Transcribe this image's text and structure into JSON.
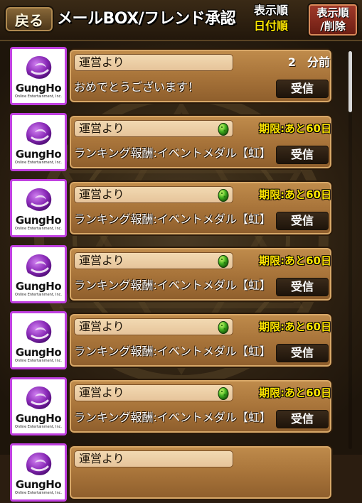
{
  "header": {
    "back_label": "戻る",
    "title": "メールBOX/フレンド承認",
    "sort_label_line1": "表示順",
    "sort_label_line2": "日付順",
    "sort_button_line1": "表示順",
    "sort_button_line2": "/削除"
  },
  "sender_logo": {
    "name": "GungHo",
    "tagline": "Online Entertainment, Inc."
  },
  "mails": [
    {
      "sender": "運営より",
      "time": "2　分前",
      "message": "おめでとうございます！",
      "receive_label": "受信"
    },
    {
      "sender": "運営より",
      "deadline": "期限:あと60日",
      "message": "ランキング報酬:イベントメダル【虹】",
      "receive_label": "受信",
      "attachment_icon": "egg-icon"
    },
    {
      "sender": "運営より",
      "deadline": "期限:あと60日",
      "message": "ランキング報酬:イベントメダル【虹】",
      "receive_label": "受信",
      "attachment_icon": "egg-icon"
    },
    {
      "sender": "運営より",
      "deadline": "期限:あと60日",
      "message": "ランキング報酬:イベントメダル【虹】",
      "receive_label": "受信",
      "attachment_icon": "egg-icon"
    },
    {
      "sender": "運営より",
      "deadline": "期限:あと60日",
      "message": "ランキング報酬:イベントメダル【虹】",
      "receive_label": "受信",
      "attachment_icon": "egg-icon"
    },
    {
      "sender": "運営より",
      "deadline": "期限:あと60日",
      "message": "ランキング報酬:イベントメダル【虹】",
      "receive_label": "受信",
      "attachment_icon": "egg-icon"
    },
    {
      "sender": "運営より"
    }
  ],
  "colors": {
    "avatar_border": "#c040e0",
    "deadline_text": "#ffe600",
    "sort_button": "#a23a2a"
  }
}
